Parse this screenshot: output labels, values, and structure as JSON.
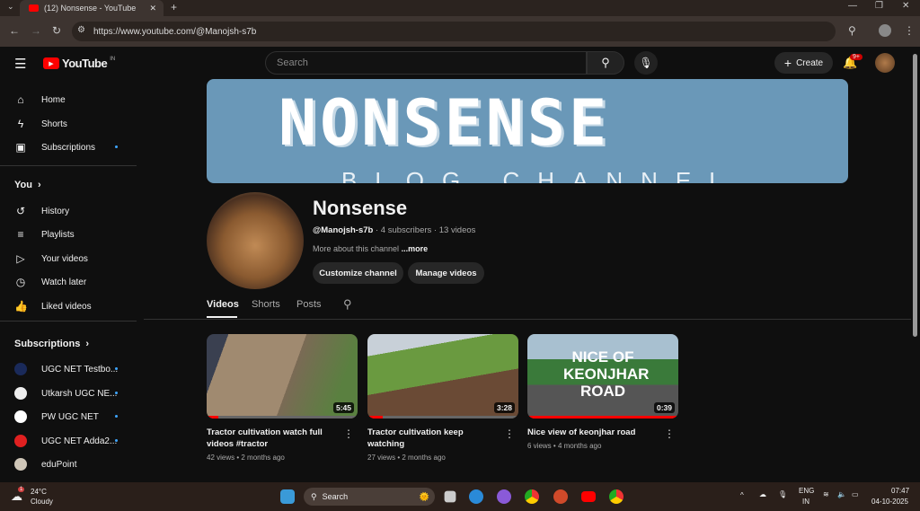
{
  "browser": {
    "tab_title": "(12) Nonsense - YouTube",
    "url": "https://www.youtube.com/@Manojsh-s7b"
  },
  "header": {
    "logo": "YouTube",
    "region": "IN",
    "search_placeholder": "Search",
    "create_label": "Create",
    "notification_count": "9+"
  },
  "sidebar": {
    "main": [
      {
        "label": "Home",
        "icon": "home-icon",
        "glyph": "⌂"
      },
      {
        "label": "Shorts",
        "icon": "shorts-icon",
        "glyph": "ϟ"
      },
      {
        "label": "Subscriptions",
        "icon": "subscriptions-icon",
        "glyph": "▣"
      }
    ],
    "you_heading": "You",
    "you": [
      {
        "label": "History",
        "glyph": "↺"
      },
      {
        "label": "Playlists",
        "glyph": "≡"
      },
      {
        "label": "Your videos",
        "glyph": "▷"
      },
      {
        "label": "Watch later",
        "glyph": "◷"
      },
      {
        "label": "Liked videos",
        "glyph": "👍"
      }
    ],
    "subs_heading": "Subscriptions",
    "subs": [
      {
        "label": "UGC NET Testbo...",
        "color": "#1a2a5a"
      },
      {
        "label": "Utkarsh UGC NE...",
        "color": "#eeeeee"
      },
      {
        "label": "PW UGC NET",
        "color": "#ffffff"
      },
      {
        "label": "UGC NET Adda2...",
        "color": "#e02020"
      },
      {
        "label": "eduPoint",
        "color": "#cfc6b8"
      }
    ]
  },
  "banner": {
    "title": "NONSENSE",
    "subtitle": "BLOG CHANNEL",
    "color": "#6a98b8"
  },
  "channel": {
    "name": "Nonsense",
    "handle": "@Manojsh-s7b",
    "subscribers": "4 subscribers",
    "videos": "13 videos",
    "about": "More about this channel",
    "more": "...more",
    "customize_label": "Customize channel",
    "manage_label": "Manage videos"
  },
  "tabs": [
    {
      "label": "Videos",
      "active": true
    },
    {
      "label": "Shorts"
    },
    {
      "label": "Posts"
    }
  ],
  "videos": [
    {
      "title": "Tractor cultivation watch full videos #tractor",
      "views": "42 views",
      "age": "2 months ago",
      "duration": "5:45",
      "watched": 0.08
    },
    {
      "title": "Tractor cultivation keep watching",
      "views": "27 views",
      "age": "2 months ago",
      "duration": "3:28",
      "watched": 0.1
    },
    {
      "title": "Nice view of keonjhar road",
      "views": "6 views",
      "age": "4 months ago",
      "duration": "0:39",
      "watched": 1.0,
      "thumb_text": "NICE OF KEONJHAR ROAD"
    }
  ],
  "taskbar": {
    "temp": "24°C",
    "weather": "Cloudy",
    "weather_badge": "1",
    "search": "Search",
    "lang": "ENG",
    "lang2": "IN",
    "time": "07:47",
    "date": "04-10-2025"
  }
}
